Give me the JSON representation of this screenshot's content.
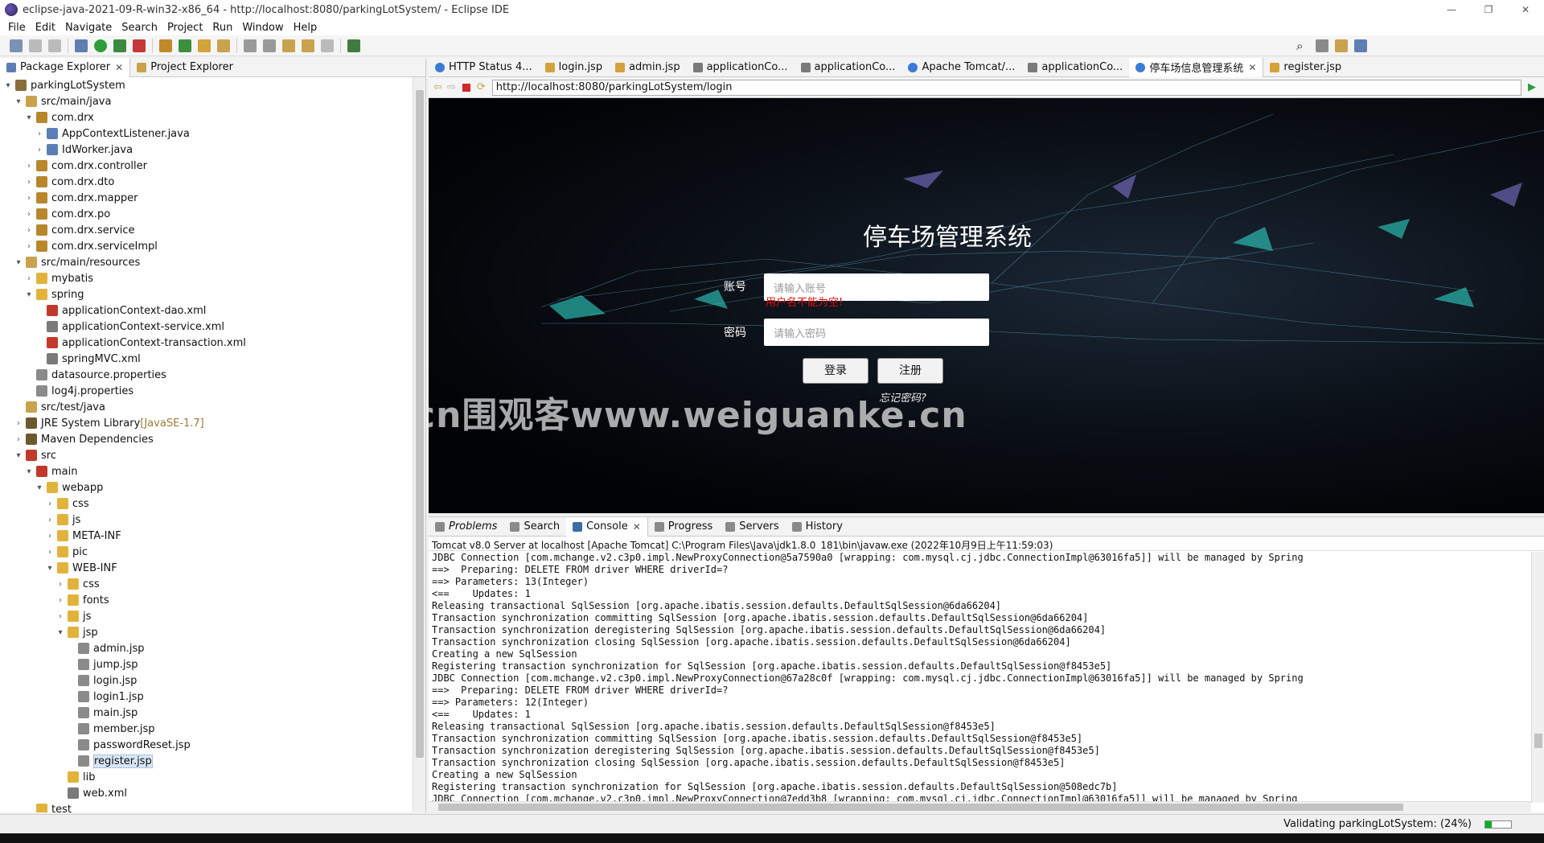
{
  "window": {
    "title": "eclipse-java-2021-09-R-win32-x86_64 - http://localhost:8080/parkingLotSystem/ - Eclipse IDE"
  },
  "menu": [
    "File",
    "Edit",
    "Navigate",
    "Search",
    "Project",
    "Run",
    "Window",
    "Help"
  ],
  "explorer": {
    "tabs": [
      {
        "label": "Package Explorer",
        "active": true
      },
      {
        "label": "Project Explorer",
        "active": false
      }
    ],
    "tree": [
      {
        "label": "parkingLotSystem",
        "depth": 0,
        "arrow": "▾",
        "icon": "project-icon",
        "color": "#8a6d3b"
      },
      {
        "label": "src/main/java",
        "depth": 1,
        "arrow": "▾",
        "icon": "source-folder-icon",
        "color": "#c9a24d"
      },
      {
        "label": "com.drx",
        "depth": 2,
        "arrow": "▾",
        "icon": "package-icon",
        "color": "#b8862b"
      },
      {
        "label": "AppContextListener.java",
        "depth": 3,
        "arrow": "›",
        "icon": "java-file-icon",
        "color": "#5b7fb5"
      },
      {
        "label": "IdWorker.java",
        "depth": 3,
        "arrow": "›",
        "icon": "java-file-icon",
        "color": "#5b7fb5"
      },
      {
        "label": "com.drx.controller",
        "depth": 2,
        "arrow": "›",
        "icon": "package-icon",
        "color": "#b8862b"
      },
      {
        "label": "com.drx.dto",
        "depth": 2,
        "arrow": "›",
        "icon": "package-icon",
        "color": "#b8862b"
      },
      {
        "label": "com.drx.mapper",
        "depth": 2,
        "arrow": "›",
        "icon": "package-icon",
        "color": "#b8862b"
      },
      {
        "label": "com.drx.po",
        "depth": 2,
        "arrow": "›",
        "icon": "package-icon",
        "color": "#b8862b"
      },
      {
        "label": "com.drx.service",
        "depth": 2,
        "arrow": "›",
        "icon": "package-icon",
        "color": "#b8862b"
      },
      {
        "label": "com.drx.serviceImpl",
        "depth": 2,
        "arrow": "›",
        "icon": "package-icon",
        "color": "#b8862b"
      },
      {
        "label": "src/main/resources",
        "depth": 1,
        "arrow": "▾",
        "icon": "source-folder-icon",
        "color": "#c9a24d"
      },
      {
        "label": "mybatis",
        "depth": 2,
        "arrow": "›",
        "icon": "folder-icon",
        "color": "#e2b33c"
      },
      {
        "label": "spring",
        "depth": 2,
        "arrow": "▾",
        "icon": "folder-icon",
        "color": "#e2b33c"
      },
      {
        "label": "applicationContext-dao.xml",
        "depth": 3,
        "arrow": "",
        "icon": "xml-file-icon",
        "color": "#c0392b"
      },
      {
        "label": "applicationContext-service.xml",
        "depth": 3,
        "arrow": "",
        "icon": "xml-file-icon",
        "color": "#7a7a7a"
      },
      {
        "label": "applicationContext-transaction.xml",
        "depth": 3,
        "arrow": "",
        "icon": "xml-file-icon",
        "color": "#c0392b"
      },
      {
        "label": "springMVC.xml",
        "depth": 3,
        "arrow": "",
        "icon": "xml-file-icon",
        "color": "#7a7a7a"
      },
      {
        "label": "datasource.properties",
        "depth": 2,
        "arrow": "",
        "icon": "properties-file-icon",
        "color": "#8a8a8a"
      },
      {
        "label": "log4j.properties",
        "depth": 2,
        "arrow": "",
        "icon": "properties-file-icon",
        "color": "#8a8a8a"
      },
      {
        "label": "src/test/java",
        "depth": 1,
        "arrow": "",
        "icon": "source-folder-icon",
        "color": "#c9a24d"
      },
      {
        "label": "JRE System Library",
        "suffix": " [JavaSE-1.7]",
        "depth": 1,
        "arrow": "›",
        "icon": "library-icon",
        "color": "#6b5a2e"
      },
      {
        "label": "Maven Dependencies",
        "depth": 1,
        "arrow": "›",
        "icon": "library-icon",
        "color": "#6b5a2e"
      },
      {
        "label": "src",
        "depth": 1,
        "arrow": "▾",
        "icon": "folder-icon",
        "color": "#c0392b"
      },
      {
        "label": "main",
        "depth": 2,
        "arrow": "▾",
        "icon": "folder-icon",
        "color": "#c0392b"
      },
      {
        "label": "webapp",
        "depth": 3,
        "arrow": "▾",
        "icon": "folder-icon",
        "color": "#e2b33c"
      },
      {
        "label": "css",
        "depth": 4,
        "arrow": "›",
        "icon": "folder-icon",
        "color": "#e2b33c"
      },
      {
        "label": "js",
        "depth": 4,
        "arrow": "›",
        "icon": "folder-icon",
        "color": "#e2b33c"
      },
      {
        "label": "META-INF",
        "depth": 4,
        "arrow": "›",
        "icon": "folder-icon",
        "color": "#e2b33c"
      },
      {
        "label": "pic",
        "depth": 4,
        "arrow": "›",
        "icon": "folder-icon",
        "color": "#e2b33c"
      },
      {
        "label": "WEB-INF",
        "depth": 4,
        "arrow": "▾",
        "icon": "folder-icon",
        "color": "#e2b33c"
      },
      {
        "label": "css",
        "depth": 5,
        "arrow": "›",
        "icon": "folder-icon",
        "color": "#e2b33c"
      },
      {
        "label": "fonts",
        "depth": 5,
        "arrow": "›",
        "icon": "folder-icon",
        "color": "#e2b33c"
      },
      {
        "label": "js",
        "depth": 5,
        "arrow": "›",
        "icon": "folder-icon",
        "color": "#e2b33c"
      },
      {
        "label": "jsp",
        "depth": 5,
        "arrow": "▾",
        "icon": "folder-icon",
        "color": "#e2b33c"
      },
      {
        "label": "admin.jsp",
        "depth": 6,
        "arrow": "",
        "icon": "jsp-file-icon",
        "color": "#8a8a8a"
      },
      {
        "label": "jump.jsp",
        "depth": 6,
        "arrow": "",
        "icon": "jsp-file-icon",
        "color": "#8a8a8a"
      },
      {
        "label": "login.jsp",
        "depth": 6,
        "arrow": "",
        "icon": "jsp-file-icon",
        "color": "#8a8a8a"
      },
      {
        "label": "login1.jsp",
        "depth": 6,
        "arrow": "",
        "icon": "jsp-file-icon",
        "color": "#8a8a8a"
      },
      {
        "label": "main.jsp",
        "depth": 6,
        "arrow": "",
        "icon": "jsp-file-icon",
        "color": "#8a8a8a"
      },
      {
        "label": "member.jsp",
        "depth": 6,
        "arrow": "",
        "icon": "jsp-file-icon",
        "color": "#8a8a8a"
      },
      {
        "label": "passwordReset.jsp",
        "depth": 6,
        "arrow": "",
        "icon": "jsp-file-icon",
        "color": "#8a8a8a"
      },
      {
        "label": "register.jsp",
        "depth": 6,
        "arrow": "",
        "icon": "jsp-file-icon",
        "color": "#8a8a8a",
        "selected": true
      },
      {
        "label": "lib",
        "depth": 5,
        "arrow": "",
        "icon": "folder-icon",
        "color": "#e2b33c"
      },
      {
        "label": "web.xml",
        "depth": 5,
        "arrow": "",
        "icon": "xml-file-icon",
        "color": "#7a7a7a"
      },
      {
        "label": "test",
        "depth": 2,
        "arrow": "",
        "icon": "folder-icon",
        "color": "#e2b33c"
      }
    ]
  },
  "editor_tabs": [
    {
      "label": "HTTP Status 4...",
      "icon": "globe-icon",
      "active": false
    },
    {
      "label": "login.jsp",
      "icon": "jsp-file-icon",
      "active": false
    },
    {
      "label": "admin.jsp",
      "icon": "jsp-file-icon",
      "active": false
    },
    {
      "label": "applicationCo...",
      "icon": "xml-file-icon",
      "active": false
    },
    {
      "label": "applicationCo...",
      "icon": "xml-file-icon",
      "active": false
    },
    {
      "label": "Apache Tomcat/...",
      "icon": "globe-icon",
      "active": false
    },
    {
      "label": "applicationCo...",
      "icon": "xml-file-icon",
      "active": false
    },
    {
      "label": "停车场信息管理系统",
      "icon": "globe-icon",
      "active": true
    },
    {
      "label": "register.jsp",
      "icon": "jsp-file-icon",
      "active": false
    }
  ],
  "browser": {
    "url": "http://localhost:8080/parkingLotSystem/login",
    "page": {
      "title": "停车场管理系统",
      "account_label": "账号",
      "account_placeholder": "请输入账号",
      "error_text": "用户名不能为空!",
      "password_label": "密码",
      "password_placeholder": "请输入密码",
      "login_button": "登录",
      "register_button": "注册",
      "forgot_link": "忘记密码?"
    },
    "watermark": "cn围观客www.weiguanke.cn"
  },
  "console": {
    "tabs": [
      {
        "label": "Problems",
        "active": false,
        "icon": "problems-icon"
      },
      {
        "label": "Search",
        "active": false,
        "icon": "search-icon"
      },
      {
        "label": "Console",
        "active": true,
        "icon": "console-icon"
      },
      {
        "label": "Progress",
        "active": false,
        "icon": "progress-icon"
      },
      {
        "label": "Servers",
        "active": false,
        "icon": "servers-icon"
      },
      {
        "label": "History",
        "active": false,
        "icon": "history-icon"
      }
    ],
    "header": "Tomcat v8.0 Server at localhost [Apache Tomcat] C:\\Program Files\\Java\\jdk1.8.0_181\\bin\\javaw.exe  (2022年10月9日上午11:59:03)",
    "lines": [
      "JDBC Connection [com.mchange.v2.c3p0.impl.NewProxyConnection@5a7590a0 [wrapping: com.mysql.cj.jdbc.ConnectionImpl@63016fa5]] will be managed by Spring",
      "==>  Preparing: DELETE FROM driver WHERE driverId=?",
      "==> Parameters: 13(Integer)",
      "<==    Updates: 1",
      "Releasing transactional SqlSession [org.apache.ibatis.session.defaults.DefaultSqlSession@6da66204]",
      "Transaction synchronization committing SqlSession [org.apache.ibatis.session.defaults.DefaultSqlSession@6da66204]",
      "Transaction synchronization deregistering SqlSession [org.apache.ibatis.session.defaults.DefaultSqlSession@6da66204]",
      "Transaction synchronization closing SqlSession [org.apache.ibatis.session.defaults.DefaultSqlSession@6da66204]",
      "Creating a new SqlSession",
      "Registering transaction synchronization for SqlSession [org.apache.ibatis.session.defaults.DefaultSqlSession@f8453e5]",
      "JDBC Connection [com.mchange.v2.c3p0.impl.NewProxyConnection@67a28c0f [wrapping: com.mysql.cj.jdbc.ConnectionImpl@63016fa5]] will be managed by Spring",
      "==>  Preparing: DELETE FROM driver WHERE driverId=?",
      "==> Parameters: 12(Integer)",
      "<==    Updates: 1",
      "Releasing transactional SqlSession [org.apache.ibatis.session.defaults.DefaultSqlSession@f8453e5]",
      "Transaction synchronization committing SqlSession [org.apache.ibatis.session.defaults.DefaultSqlSession@f8453e5]",
      "Transaction synchronization deregistering SqlSession [org.apache.ibatis.session.defaults.DefaultSqlSession@f8453e5]",
      "Transaction synchronization closing SqlSession [org.apache.ibatis.session.defaults.DefaultSqlSession@f8453e5]",
      "Creating a new SqlSession",
      "Registering transaction synchronization for SqlSession [org.apache.ibatis.session.defaults.DefaultSqlSession@508edc7b]",
      "JDBC Connection [com.mchange.v2.c3p0.impl.NewProxyConnection@7edd3b8 [wrapping: com.mysql.cj.jdbc.ConnectionImpl@63016fa5]] will be managed by Spring"
    ]
  },
  "status": {
    "text": "Validating parkingLotSystem: (24%)",
    "progress": 0.24
  },
  "colors": {
    "accent": "#d9e6f7",
    "progress": "#06b025",
    "error": "#e01010"
  }
}
